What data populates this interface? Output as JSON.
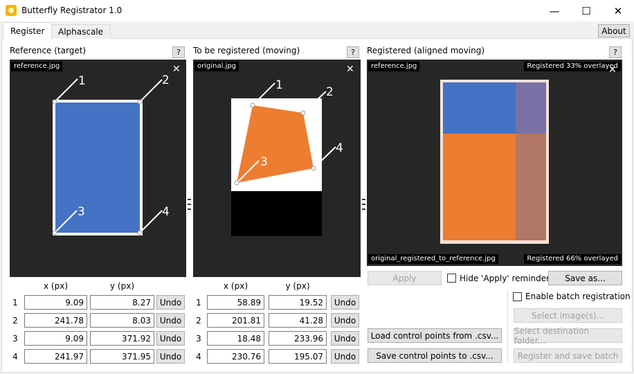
{
  "window": {
    "title": "Butterfly Registrator 1.0",
    "minimize": "—",
    "maximize": "☐",
    "close": "✕"
  },
  "tabs": [
    {
      "label": "Register"
    },
    {
      "label": "Alphascale"
    }
  ],
  "about_label": "About",
  "help_label": "?",
  "panels": {
    "reference": {
      "label": "Reference (target)",
      "file": "reference.jpg"
    },
    "moving": {
      "label": "To be registered (moving)",
      "file": "original.jpg"
    },
    "registered": {
      "label": "Registered (aligned moving)",
      "file_top": "reference.jpg",
      "overlay_top": "Registered 33% overlayed",
      "file_bottom": "original_registered_to_reference.jpg",
      "overlay_bottom": "Registered 66% overlayed"
    }
  },
  "close_glyph": "✕",
  "point_labels": [
    "1",
    "2",
    "3",
    "4"
  ],
  "columns": {
    "x": "x (px)",
    "y": "y (px)"
  },
  "undo_label": "Undo",
  "reference_points": [
    {
      "n": "1",
      "x": "9.09",
      "y": "8.27"
    },
    {
      "n": "2",
      "x": "241.78",
      "y": "8.03"
    },
    {
      "n": "3",
      "x": "9.09",
      "y": "371.92"
    },
    {
      "n": "4",
      "x": "241.97",
      "y": "371.95"
    }
  ],
  "moving_points": [
    {
      "n": "1",
      "x": "58.89",
      "y": "19.52"
    },
    {
      "n": "2",
      "x": "201.81",
      "y": "41.28"
    },
    {
      "n": "3",
      "x": "18.48",
      "y": "233.96"
    },
    {
      "n": "4",
      "x": "230.76",
      "y": "195.07"
    }
  ],
  "actions": {
    "apply": "Apply",
    "hide_reminder": "Hide 'Apply' reminder",
    "save_as": "Save as...",
    "enable_batch": "Enable batch registration",
    "select_images": "Select image(s)...",
    "select_destination": "Select destination folder...",
    "register_batch": "Register and save batch",
    "load_csv": "Load control points from .csv...",
    "save_csv": "Save control points to .csv..."
  },
  "colors": {
    "blue": "#4472c4",
    "orange": "#ed7d31",
    "viewer_bg": "#262626"
  }
}
